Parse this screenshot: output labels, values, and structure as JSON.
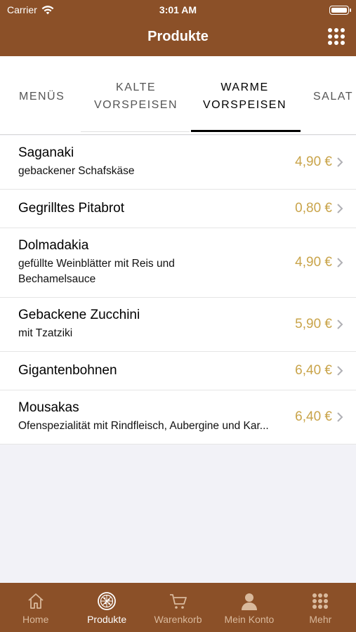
{
  "status_bar": {
    "carrier": "Carrier",
    "time": "3:01 AM"
  },
  "nav": {
    "title": "Produkte"
  },
  "tabs": [
    {
      "line1": "MENÜS",
      "line2": ""
    },
    {
      "line1": "KALTE",
      "line2": "VORSPEISEN"
    },
    {
      "line1": "WARME",
      "line2": "VORSPEISEN"
    },
    {
      "line1": "SALAT",
      "line2": ""
    }
  ],
  "products": [
    {
      "name": "Saganaki",
      "desc": "gebackener Schafskäse",
      "price": "4,90 €"
    },
    {
      "name": "Gegrilltes Pitabrot",
      "desc": "",
      "price": "0,80 €"
    },
    {
      "name": "Dolmadakia",
      "desc": "gefüllte Weinblätter mit Reis und Bechamelsauce",
      "price": "4,90 €"
    },
    {
      "name": "Gebackene Zucchini",
      "desc": "mit Tzatziki",
      "price": "5,90 €"
    },
    {
      "name": "Gigantenbohnen",
      "desc": "",
      "price": "6,40 €"
    },
    {
      "name": "Mousakas",
      "desc": "Ofenspezialität mit Rindfleisch, Aubergine und Kar...",
      "price": "6,40 €"
    }
  ],
  "tabbar": [
    {
      "label": "Home",
      "icon": "home-icon"
    },
    {
      "label": "Produkte",
      "icon": "pizza-icon"
    },
    {
      "label": "Warenkorb",
      "icon": "cart-icon"
    },
    {
      "label": "Mein Konto",
      "icon": "person-icon"
    },
    {
      "label": "Mehr",
      "icon": "grid-icon"
    }
  ],
  "colors": {
    "brand": "#8b5028",
    "price": "#c9a44a",
    "tab_inactive": "#d9b99c"
  }
}
